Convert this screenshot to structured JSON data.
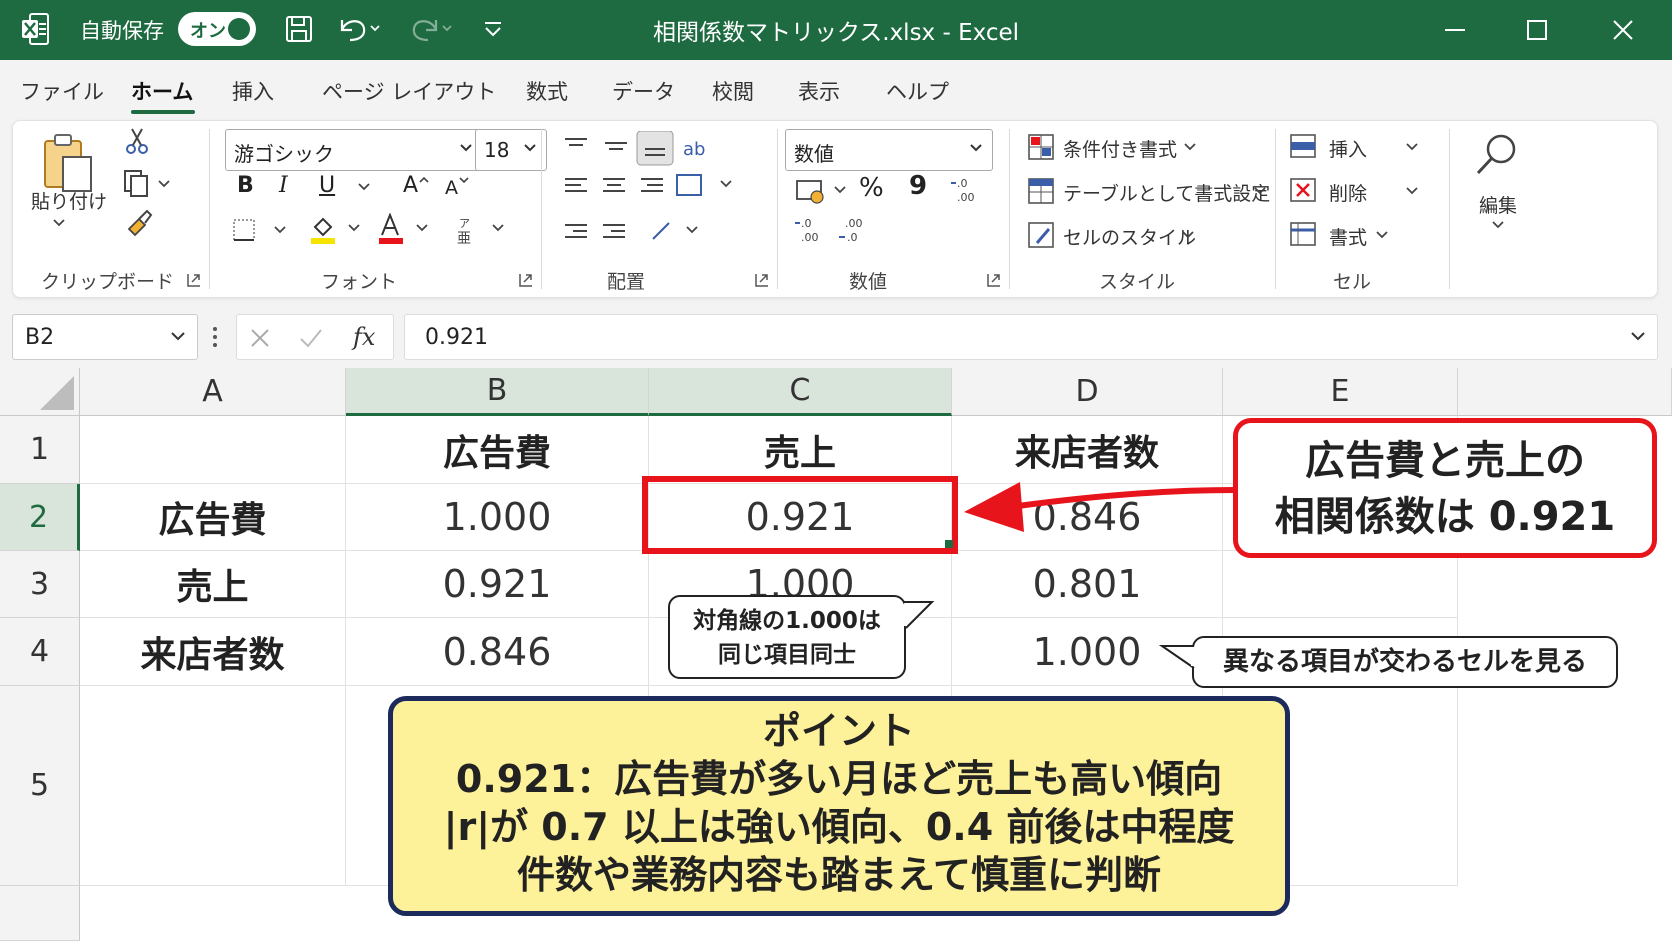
{
  "titlebar": {
    "autosave_label": "自動保存",
    "autosave_state": "オン",
    "document_title": "相関係数マトリックス.xlsx  -  Excel"
  },
  "menu": {
    "tabs": [
      "ファイル",
      "ホーム",
      "挿入",
      "ページ レイアウト",
      "数式",
      "データ",
      "校閲",
      "表示",
      "ヘルプ"
    ],
    "active": "ホーム"
  },
  "ribbon": {
    "clipboard": {
      "paste_label": "貼り付け",
      "group": "クリップボード"
    },
    "font": {
      "font_name": "游ゴシック",
      "font_size": "18",
      "group": "フォント",
      "bold": "B",
      "italic": "I",
      "underline": "U",
      "grow": "A",
      "shrink": "A"
    },
    "alignment": {
      "group": "配置"
    },
    "number": {
      "format": "数値",
      "percent": "%",
      "comma": "9",
      "group": "数値"
    },
    "styles": {
      "conditional": "条件付き書式",
      "table": "テーブルとして書式設定",
      "cell_styles": "セルのスタイル",
      "group": "スタイル"
    },
    "cells": {
      "insert": "挿入",
      "delete": "削除",
      "format": "書式",
      "group": "セル"
    },
    "editing": {
      "label": "編集"
    }
  },
  "formulabar": {
    "namebox": "B2",
    "fx": "fx",
    "value": "0.921"
  },
  "sheet": {
    "columns": [
      "A",
      "B",
      "C",
      "D",
      "E"
    ],
    "rows": [
      "1",
      "2",
      "3",
      "4",
      "5"
    ],
    "headers": [
      "広告費",
      "売上",
      "来店者数"
    ],
    "row_labels": [
      "広告費",
      "売上",
      "来店者数"
    ],
    "matrix": [
      [
        "1.000",
        "0.921",
        "0.846"
      ],
      [
        "0.921",
        "1.000",
        "0.801"
      ],
      [
        "0.846",
        "",
        "1.000"
      ]
    ]
  },
  "annotations": {
    "callout_right_line1": "広告費と売上の",
    "callout_right_line2": "相関係数は 0.921",
    "diag_line1": "対角線の1.000は",
    "diag_line2": "同じ項目同士",
    "right_note": "異なる項目が交わるセルを見る",
    "point_title": "ポイント",
    "point_line1": "0.921：広告費が多い月ほど売上も高い傾向",
    "point_line2": "|r|が 0.7 以上は強い傾向、0.4 前後は中程度",
    "point_line3": "件数や業務内容も踏まえて慎重に判断"
  },
  "colors": {
    "excel_green": "#1e6b41",
    "callout_red": "#e8141c",
    "point_yellow": "#fdf19a",
    "point_border": "#1c2a5c"
  }
}
